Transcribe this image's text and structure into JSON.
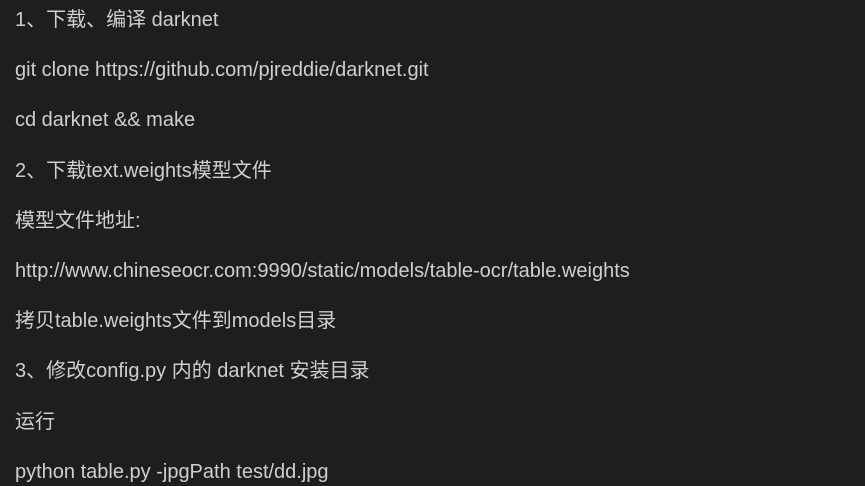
{
  "document": {
    "lines": [
      "1、下载、编译 darknet",
      "git clone https://github.com/pjreddie/darknet.git",
      "cd darknet && make",
      "2、下载text.weights模型文件",
      "模型文件地址:",
      "http://www.chineseocr.com:9990/static/models/table-ocr/table.weights",
      "拷贝table.weights文件到models目录",
      "3、修改config.py 内的 darknet 安装目录",
      "运行",
      "python  table.py -jpgPath  test/dd.jpg"
    ]
  },
  "colors": {
    "background": "#1e1e1e",
    "text": "#cfcfcf"
  }
}
